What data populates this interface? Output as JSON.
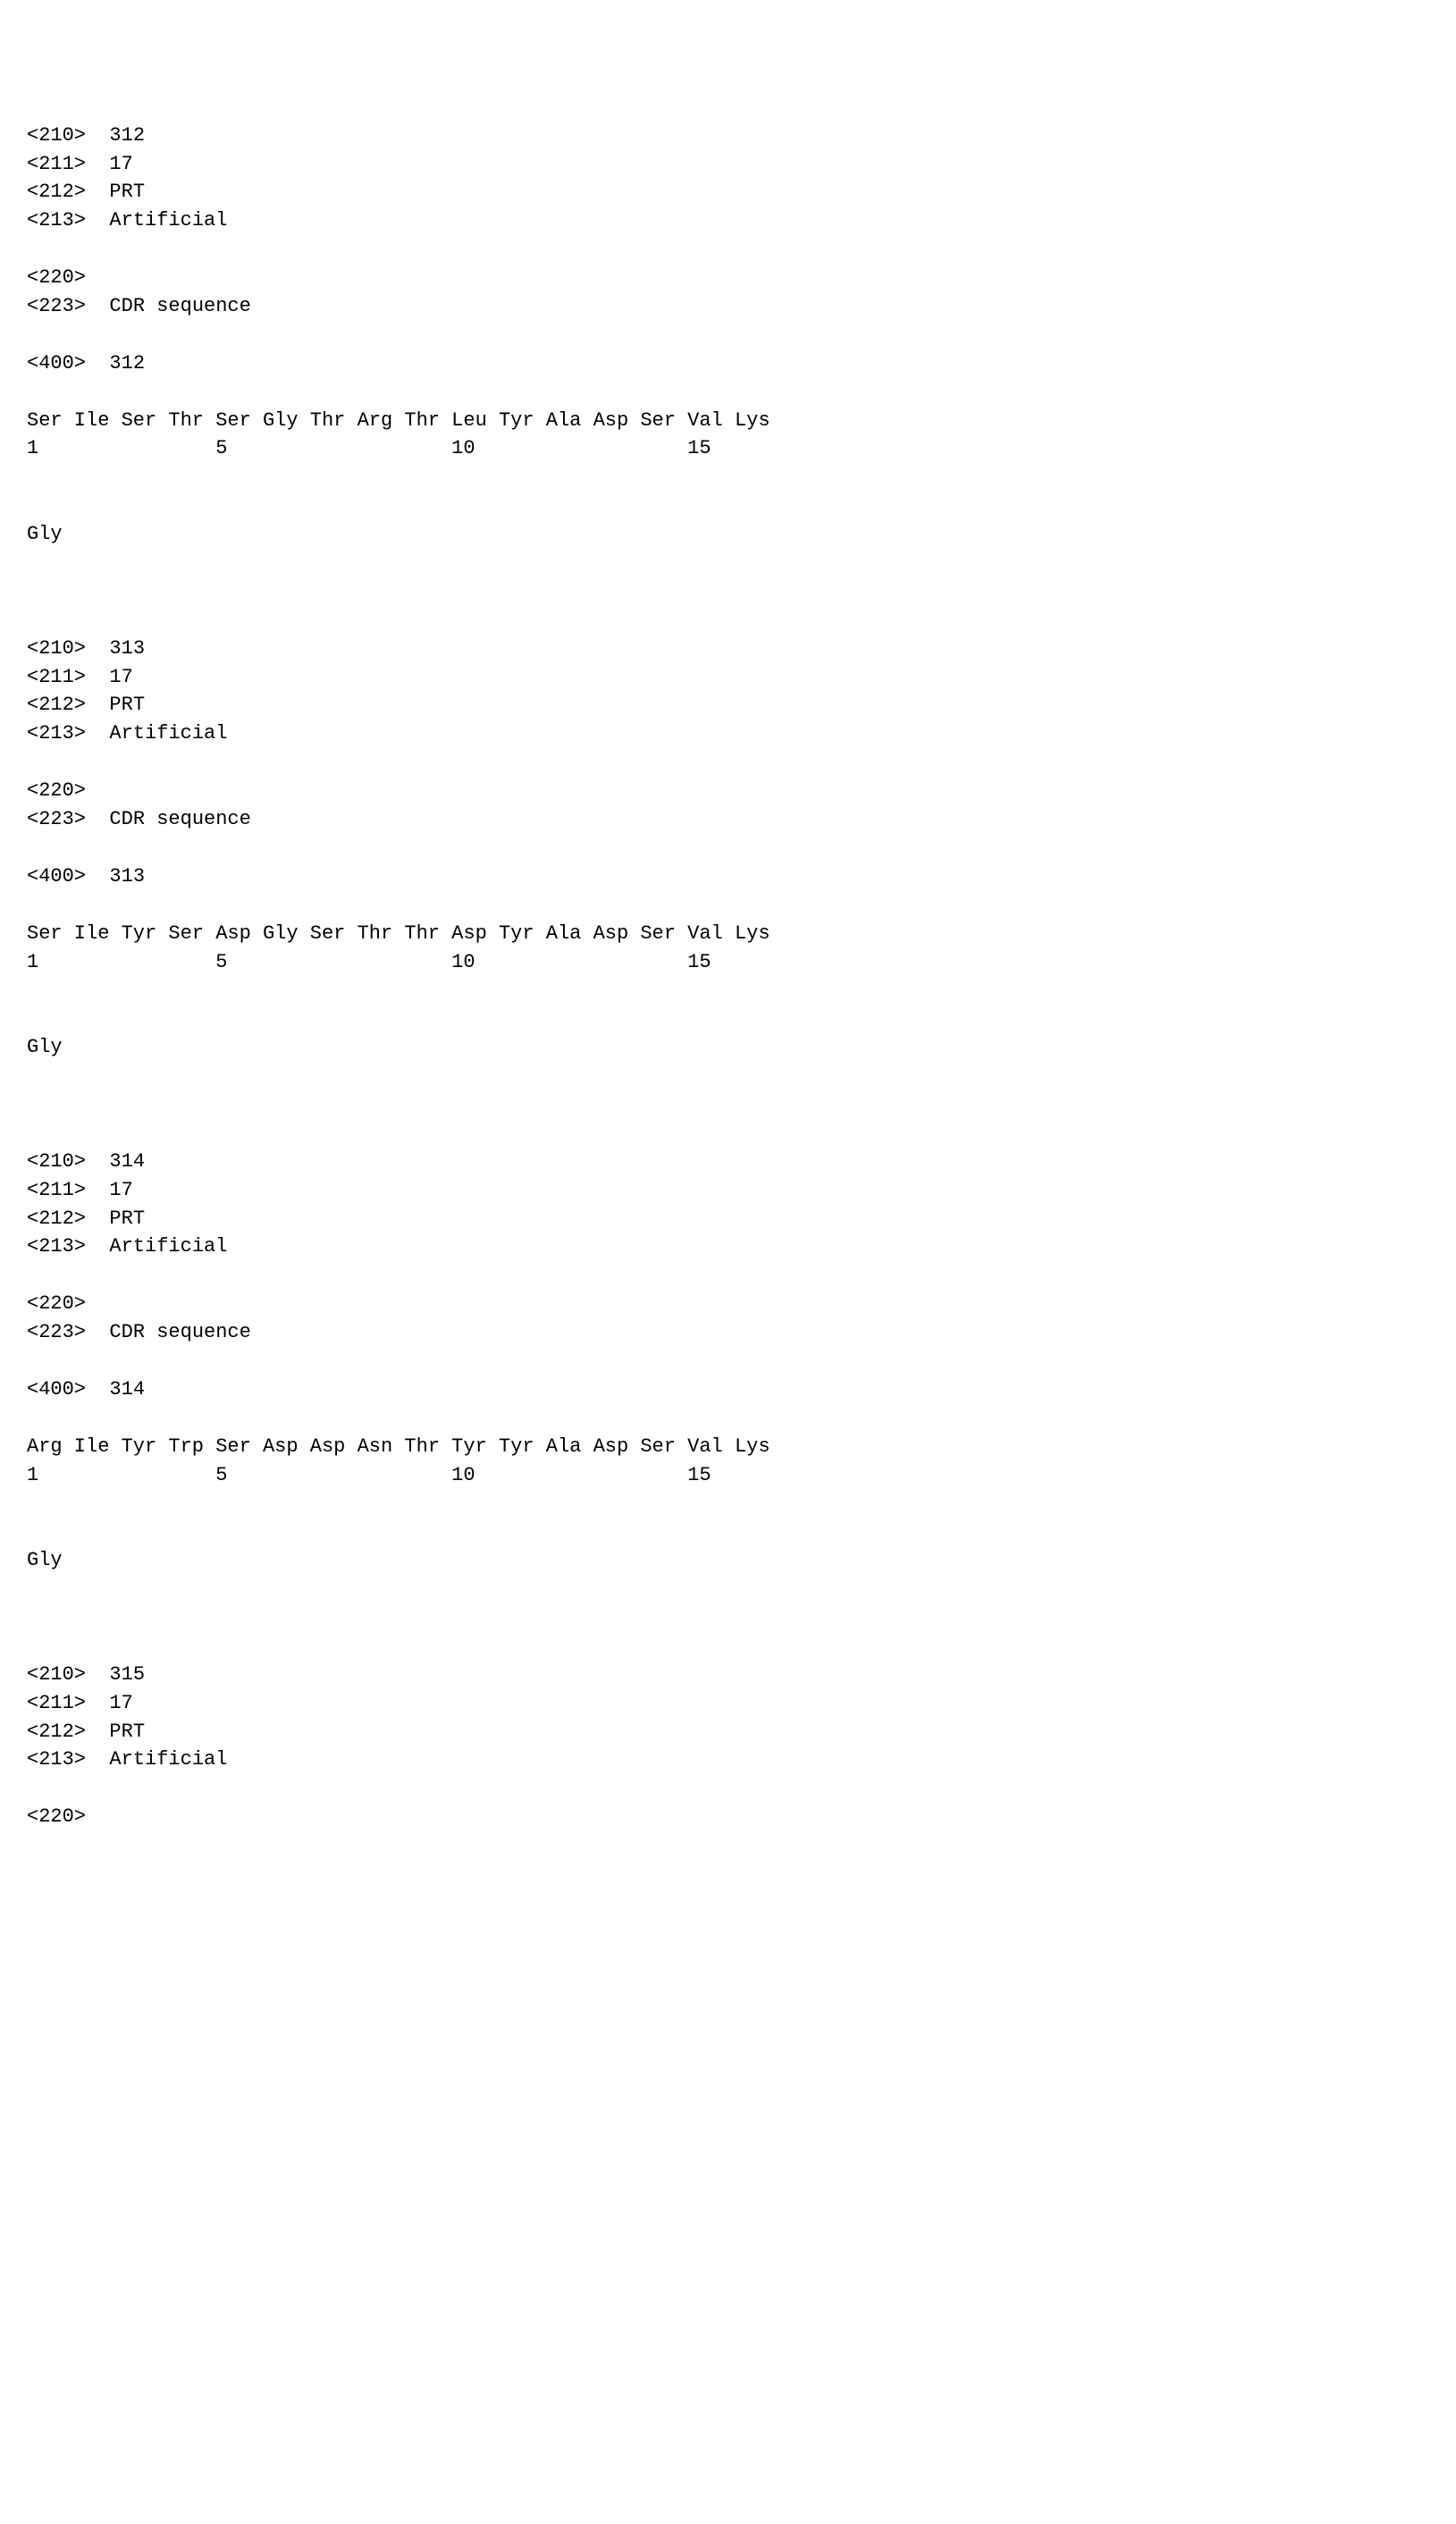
{
  "entries": [
    {
      "h210": "<210>  312",
      "h211": "<211>  17",
      "h212": "<212>  PRT",
      "h213": "<213>  Artificial",
      "h220": "<220>",
      "h223": "<223>  CDR sequence",
      "h400": "<400>  312",
      "seq": [
        "Ser",
        "Ile",
        "Ser",
        "Thr",
        "Ser",
        "Gly",
        "Thr",
        "Arg",
        "Thr",
        "Leu",
        "Tyr",
        "Ala",
        "Asp",
        "Ser",
        "Val",
        "Lys"
      ],
      "nums": [
        "1",
        "",
        "",
        "",
        "5",
        "",
        "",
        "",
        "",
        "10",
        "",
        "",
        "",
        "",
        "15",
        ""
      ],
      "tail": "Gly"
    },
    {
      "h210": "<210>  313",
      "h211": "<211>  17",
      "h212": "<212>  PRT",
      "h213": "<213>  Artificial",
      "h220": "<220>",
      "h223": "<223>  CDR sequence",
      "h400": "<400>  313",
      "seq": [
        "Ser",
        "Ile",
        "Tyr",
        "Ser",
        "Asp",
        "Gly",
        "Ser",
        "Thr",
        "Thr",
        "Asp",
        "Tyr",
        "Ala",
        "Asp",
        "Ser",
        "Val",
        "Lys"
      ],
      "nums": [
        "1",
        "",
        "",
        "",
        "5",
        "",
        "",
        "",
        "",
        "10",
        "",
        "",
        "",
        "",
        "15",
        ""
      ],
      "tail": "Gly"
    },
    {
      "h210": "<210>  314",
      "h211": "<211>  17",
      "h212": "<212>  PRT",
      "h213": "<213>  Artificial",
      "h220": "<220>",
      "h223": "<223>  CDR sequence",
      "h400": "<400>  314",
      "seq": [
        "Arg",
        "Ile",
        "Tyr",
        "Trp",
        "Ser",
        "Asp",
        "Asp",
        "Asn",
        "Thr",
        "Tyr",
        "Tyr",
        "Ala",
        "Asp",
        "Ser",
        "Val",
        "Lys"
      ],
      "nums": [
        "1",
        "",
        "",
        "",
        "5",
        "",
        "",
        "",
        "",
        "10",
        "",
        "",
        "",
        "",
        "15",
        ""
      ],
      "tail": "Gly"
    }
  ],
  "partial": {
    "h210": "<210>  315",
    "h211": "<211>  17",
    "h212": "<212>  PRT",
    "h213": "<213>  Artificial",
    "h220": "<220>"
  }
}
